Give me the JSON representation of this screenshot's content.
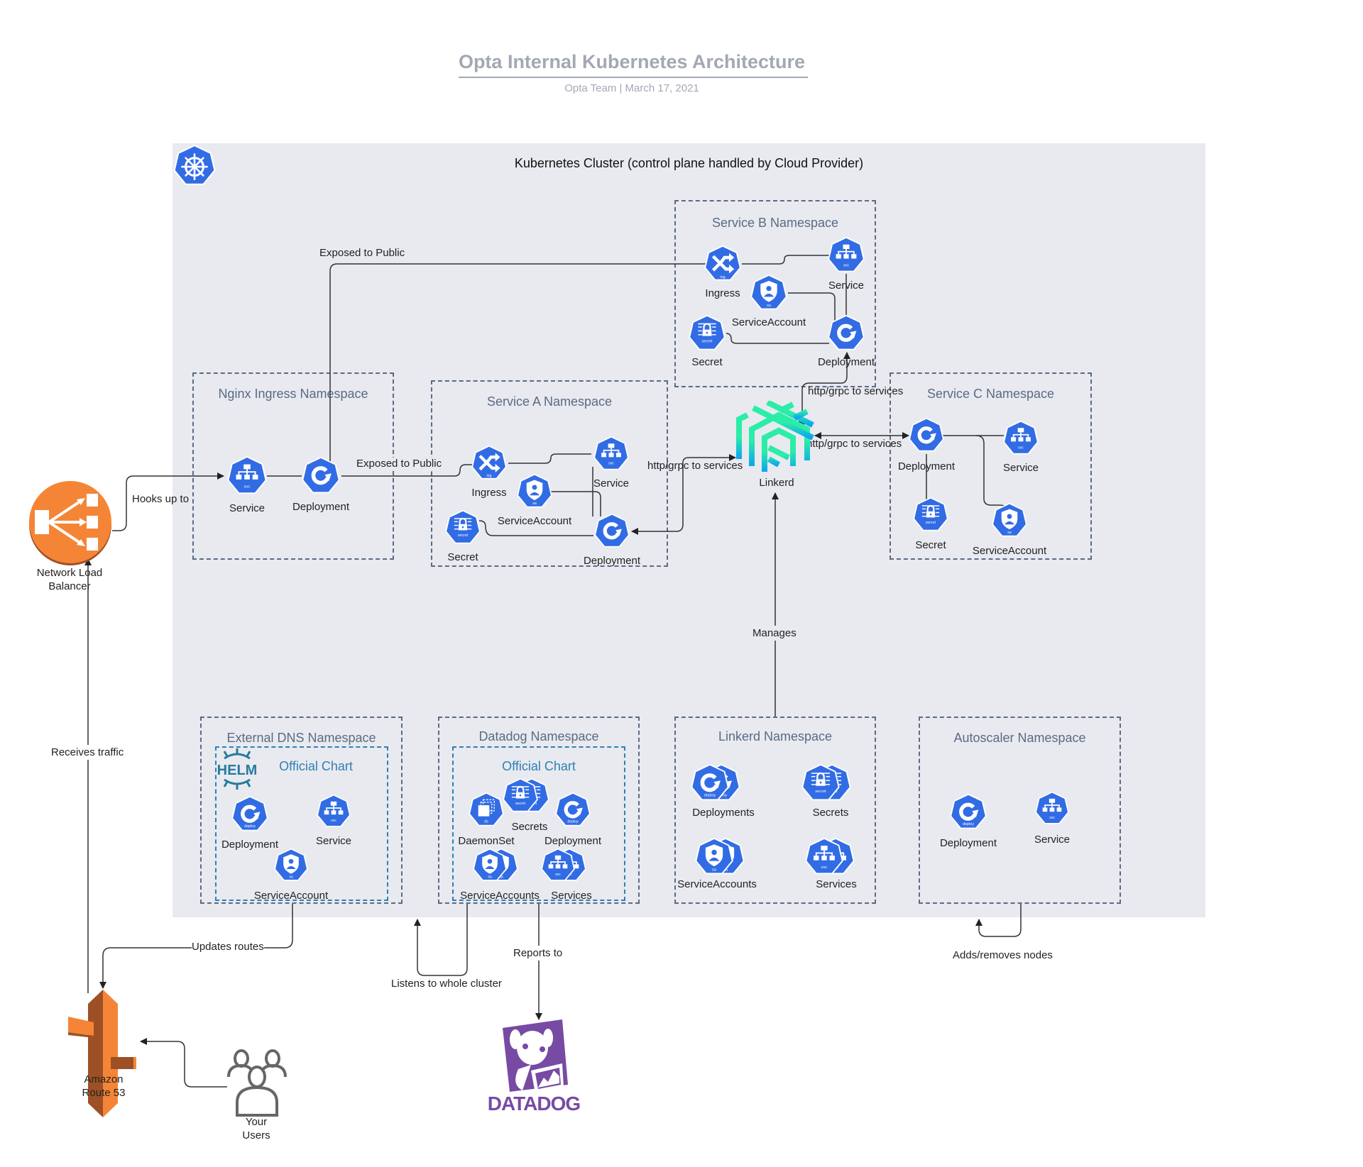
{
  "header": {
    "title": "Opta Internal Kubernetes Architecture",
    "subtitle": "Opta Team  |  March 17, 2021"
  },
  "colors": {
    "k8s_blue": "#326ce5",
    "aws_orange": "#f58536",
    "aws_dark_orange": "#9d5025",
    "linkerd_green": "#2beda7",
    "linkerd_blue": "#0ba4f2",
    "datadog_purple": "#774aa4",
    "namespace_border": "#5a6b85",
    "chart_border": "#2f7fb5",
    "cluster_bg": "#e8eaef"
  },
  "cluster": {
    "title": "Kubernetes Cluster (control plane handled by Cloud Provider)",
    "icon": "kubernetes-helm-wheel-icon"
  },
  "namespaces": {
    "nginx": {
      "title": "Nginx Ingress Namespace",
      "items": [
        "Service",
        "Deployment"
      ]
    },
    "service_a": {
      "title": "Service A Namespace",
      "items": [
        "Ingress",
        "Service",
        "ServiceAccount",
        "Secret",
        "Deployment"
      ]
    },
    "service_b": {
      "title": "Service B Namespace",
      "items": [
        "Ingress",
        "Service",
        "ServiceAccount",
        "Secret",
        "Deployment"
      ]
    },
    "service_c": {
      "title": "Service C Namespace",
      "items": [
        "Deployment",
        "Service",
        "Secret",
        "ServiceAccount"
      ]
    },
    "external_dns": {
      "title": "External DNS Namespace",
      "chart_title": "Official Chart",
      "items": [
        "Deployment",
        "Service",
        "ServiceAccount"
      ]
    },
    "datadog": {
      "title": "Datadog Namespace",
      "chart_title": "Official Chart",
      "items": [
        "DaemonSet",
        "Secrets",
        "Deployment",
        "ServiceAccounts",
        "Services"
      ]
    },
    "linkerd": {
      "title": "Linkerd Namespace",
      "items": [
        "Deployments",
        "Secrets",
        "ServiceAccounts",
        "Services"
      ]
    },
    "autoscaler": {
      "title": "Autoscaler Namespace",
      "items": [
        "Deployment",
        "Service"
      ]
    }
  },
  "icon_tags": {
    "svc": "svc",
    "deploy": "deploy",
    "sa": "sa",
    "secret": "secret",
    "ing": "ing",
    "ds": "ds"
  },
  "external": {
    "nlb": "Network Load\nBalancer",
    "nlb_line1": "Network Load",
    "nlb_line2": "Balancer",
    "route53_line1": "Amazon",
    "route53_line2": "Route 53",
    "users_line1": "Your",
    "users_line2": "Users",
    "linkerd": "Linkerd",
    "datadog": "DATADOG",
    "helm": "HELM"
  },
  "edges": {
    "exposed_public_b": "Exposed to Public",
    "exposed_public_a": "Exposed to Public",
    "hooks_up_to": "Hooks up to",
    "grpc_a": "http/grpc to services",
    "grpc_b": "http/grpc to services",
    "grpc_c": "http/grpc to services",
    "manages": "Manages",
    "receives_traffic": "Receives traffic",
    "updates_routes": "Updates routes",
    "listens": "Listens to whole cluster",
    "reports_to": "Reports to",
    "adds_removes": "Adds/removes nodes"
  }
}
